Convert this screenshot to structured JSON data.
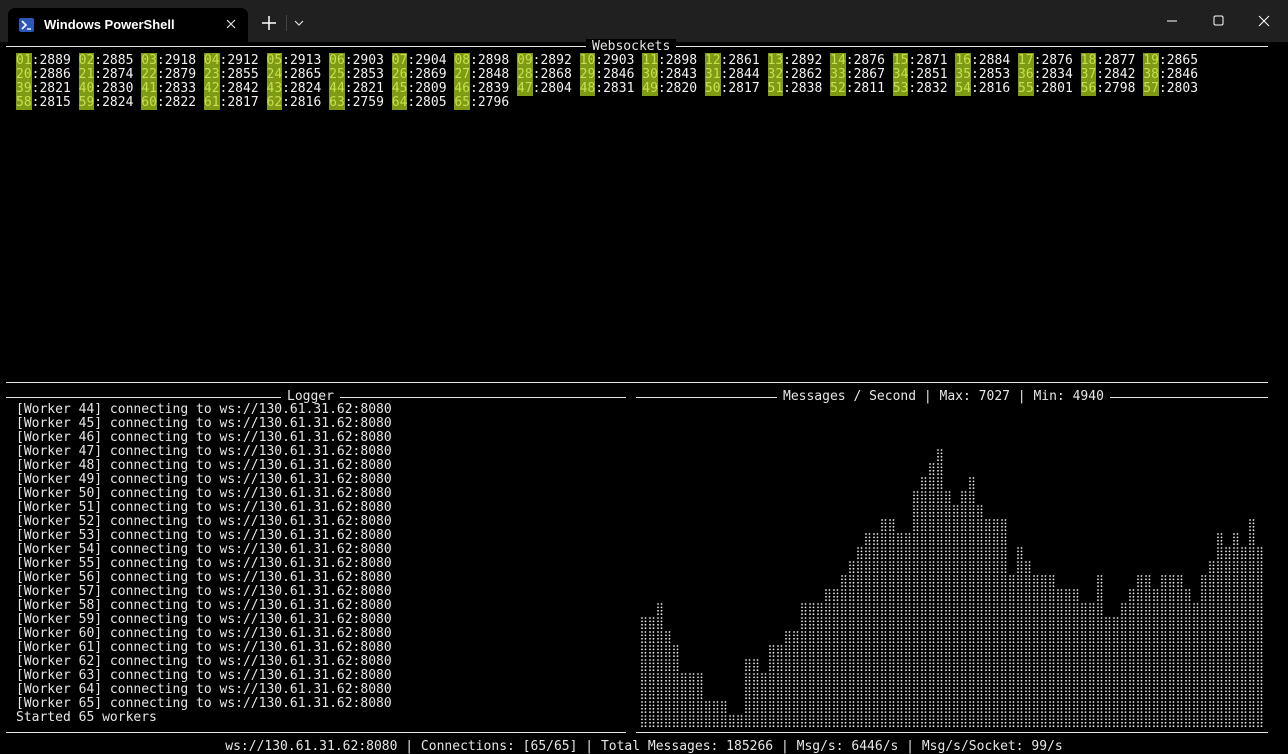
{
  "window": {
    "tab_title": "Windows PowerShell",
    "tab_icon": "powershell-icon"
  },
  "websockets": {
    "title": "Websockets",
    "rows": [
      [
        [
          "01",
          "2889"
        ],
        [
          "02",
          "2885"
        ],
        [
          "03",
          "2918"
        ],
        [
          "04",
          "2912"
        ],
        [
          "05",
          "2913"
        ],
        [
          "06",
          "2903"
        ],
        [
          "07",
          "2904"
        ],
        [
          "08",
          "2898"
        ],
        [
          "09",
          "2892"
        ],
        [
          "10",
          "2903"
        ],
        [
          "11",
          "2898"
        ],
        [
          "12",
          "2861"
        ],
        [
          "13",
          "2892"
        ],
        [
          "14",
          "2876"
        ],
        [
          "15",
          "2871"
        ],
        [
          "16",
          "2884"
        ],
        [
          "17",
          "2876"
        ],
        [
          "18",
          "2877"
        ],
        [
          "19",
          "2865"
        ]
      ],
      [
        [
          "20",
          "2886"
        ],
        [
          "21",
          "2874"
        ],
        [
          "22",
          "2879"
        ],
        [
          "23",
          "2855"
        ],
        [
          "24",
          "2865"
        ],
        [
          "25",
          "2853"
        ],
        [
          "26",
          "2869"
        ],
        [
          "27",
          "2848"
        ],
        [
          "28",
          "2868"
        ],
        [
          "29",
          "2846"
        ],
        [
          "30",
          "2843"
        ],
        [
          "31",
          "2844"
        ],
        [
          "32",
          "2862"
        ],
        [
          "33",
          "2867"
        ],
        [
          "34",
          "2851"
        ],
        [
          "35",
          "2853"
        ],
        [
          "36",
          "2834"
        ],
        [
          "37",
          "2842"
        ],
        [
          "38",
          "2846"
        ]
      ],
      [
        [
          "39",
          "2821"
        ],
        [
          "40",
          "2830"
        ],
        [
          "41",
          "2833"
        ],
        [
          "42",
          "2842"
        ],
        [
          "43",
          "2824"
        ],
        [
          "44",
          "2821"
        ],
        [
          "45",
          "2809"
        ],
        [
          "46",
          "2839"
        ],
        [
          "47",
          "2804"
        ],
        [
          "48",
          "2831"
        ],
        [
          "49",
          "2820"
        ],
        [
          "50",
          "2817"
        ],
        [
          "51",
          "2838"
        ],
        [
          "52",
          "2811"
        ],
        [
          "53",
          "2832"
        ],
        [
          "54",
          "2816"
        ],
        [
          "55",
          "2801"
        ],
        [
          "56",
          "2798"
        ],
        [
          "57",
          "2803"
        ]
      ],
      [
        [
          "58",
          "2815"
        ],
        [
          "59",
          "2824"
        ],
        [
          "60",
          "2822"
        ],
        [
          "61",
          "2817"
        ],
        [
          "62",
          "2816"
        ],
        [
          "63",
          "2759"
        ],
        [
          "64",
          "2805"
        ],
        [
          "65",
          "2796"
        ]
      ]
    ]
  },
  "logger": {
    "title": "Logger",
    "lines": [
      "[Worker 44] connecting to ws://130.61.31.62:8080",
      "[Worker 45] connecting to ws://130.61.31.62:8080",
      "[Worker 46] connecting to ws://130.61.31.62:8080",
      "[Worker 47] connecting to ws://130.61.31.62:8080",
      "[Worker 48] connecting to ws://130.61.31.62:8080",
      "[Worker 49] connecting to ws://130.61.31.62:8080",
      "[Worker 50] connecting to ws://130.61.31.62:8080",
      "[Worker 51] connecting to ws://130.61.31.62:8080",
      "[Worker 52] connecting to ws://130.61.31.62:8080",
      "[Worker 53] connecting to ws://130.61.31.62:8080",
      "[Worker 54] connecting to ws://130.61.31.62:8080",
      "[Worker 55] connecting to ws://130.61.31.62:8080",
      "[Worker 56] connecting to ws://130.61.31.62:8080",
      "[Worker 57] connecting to ws://130.61.31.62:8080",
      "[Worker 58] connecting to ws://130.61.31.62:8080",
      "[Worker 59] connecting to ws://130.61.31.62:8080",
      "[Worker 60] connecting to ws://130.61.31.62:8080",
      "[Worker 61] connecting to ws://130.61.31.62:8080",
      "[Worker 62] connecting to ws://130.61.31.62:8080",
      "[Worker 63] connecting to ws://130.61.31.62:8080",
      "[Worker 64] connecting to ws://130.61.31.62:8080",
      "[Worker 65] connecting to ws://130.61.31.62:8080",
      "Started 65 workers"
    ]
  },
  "graph": {
    "title": "Messages / Second | Max: 7027 | Min: 4940",
    "glyph": "⣿"
  },
  "chart_data": {
    "type": "bar",
    "max": 7027,
    "min": 4940,
    "values": [
      8,
      8,
      9,
      7,
      6,
      4,
      4,
      4,
      2,
      2,
      2,
      1,
      1,
      5,
      5,
      4,
      6,
      6,
      7,
      7,
      9,
      9,
      9,
      10,
      10,
      11,
      12,
      13,
      14,
      14,
      15,
      15,
      14,
      14,
      17,
      18,
      19,
      20,
      17,
      16,
      17,
      18,
      16,
      15,
      15,
      15,
      11,
      13,
      12,
      11,
      11,
      11,
      10,
      10,
      10,
      9,
      9,
      11,
      8,
      8,
      9,
      10,
      11,
      11,
      10,
      11,
      11,
      11,
      10,
      9,
      11,
      12,
      14,
      13,
      14,
      13,
      15,
      13
    ]
  },
  "statusbar": {
    "text": "ws://130.61.31.62:8080 | Connections: [65/65] | Total Messages: 185266 | Msg/s: 6446/s | Msg/s/Socket: 99/s"
  }
}
